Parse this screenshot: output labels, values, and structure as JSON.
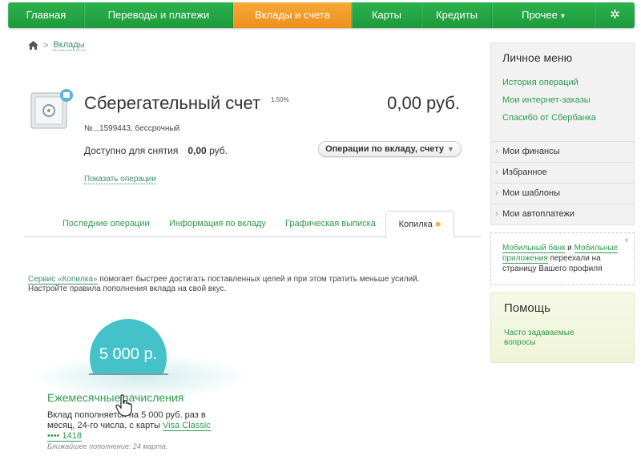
{
  "nav": {
    "items": [
      "Главная",
      "Переводы и платежи",
      "Вклады и счета",
      "Карты",
      "Кредиты",
      "Прочее"
    ],
    "active": "Вклады и счета",
    "more_caret": "▾",
    "gear": "✲"
  },
  "breadcrumb": {
    "separator": ">",
    "link": "Вклады"
  },
  "account": {
    "title": "Сберегательный счет",
    "rate": "1,50%",
    "amount": "0,00 руб.",
    "number": "№...1599443, бессрочный",
    "available_label": "Доступно для снятия",
    "available_value": "0,00",
    "available_currency": "руб.",
    "operations_button": "Операции по вкладу, счету",
    "show_operations": "Показать операции"
  },
  "tabs": {
    "items": [
      "Последние операции",
      "Информация по вкладу",
      "Графическая выписка"
    ],
    "active": "Копилка"
  },
  "description": {
    "link": "Сервис «Копилка»",
    "text": " помогает быстрее достигать поставленных целей и при этом тратить меньше усилий. Настройте правила пополнения вклада на свой вкус."
  },
  "kopilka": {
    "amount": "5 000 р.",
    "title": "Ежемесячные зачисления",
    "text": "Вклад пополняется на 5 000 руб. раз в месяц, 24-го числа, с карты ",
    "card_link": "Visa Classic •••• 1418",
    "next": "Ближайшее пополнение: 24 марта."
  },
  "sidebar": {
    "title": "Личное меню",
    "links": [
      "История операций",
      "Мои интернет-заказы",
      "Спасибо от Сбербанка"
    ],
    "items": [
      "Мои финансы",
      "Избранное",
      "Мои шаблоны",
      "Мои автоплатежи"
    ]
  },
  "mobile_notice": {
    "link1": "Мобильный банк",
    "and": " и ",
    "link2": "Мобильные приложения",
    "text": " переехали на страницу Вашего профиля",
    "close": "×"
  },
  "help": {
    "title": "Помощь",
    "link": "Часто задаваемые вопросы"
  },
  "colors": {
    "green": "#2e9a4e",
    "nav_green": "#1e9a3c",
    "orange": "#ee8f1c",
    "teal": "#45c2c9"
  }
}
